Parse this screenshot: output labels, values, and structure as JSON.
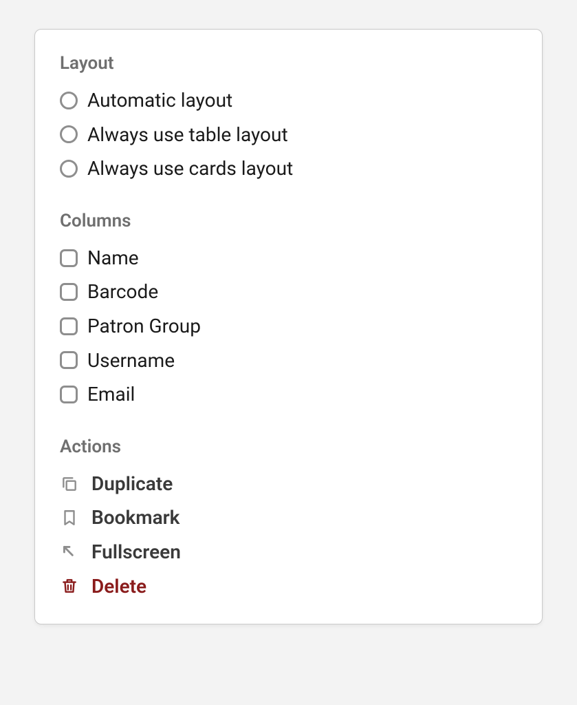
{
  "sections": {
    "layout": {
      "title": "Layout",
      "options": [
        {
          "label": "Automatic layout"
        },
        {
          "label": "Always use table layout"
        },
        {
          "label": "Always use cards layout"
        }
      ]
    },
    "columns": {
      "title": "Columns",
      "options": [
        {
          "label": "Name"
        },
        {
          "label": "Barcode"
        },
        {
          "label": "Patron Group"
        },
        {
          "label": "Username"
        },
        {
          "label": "Email"
        }
      ]
    },
    "actions": {
      "title": "Actions",
      "items": [
        {
          "label": "Duplicate"
        },
        {
          "label": "Bookmark"
        },
        {
          "label": "Fullscreen"
        },
        {
          "label": "Delete"
        }
      ]
    }
  }
}
